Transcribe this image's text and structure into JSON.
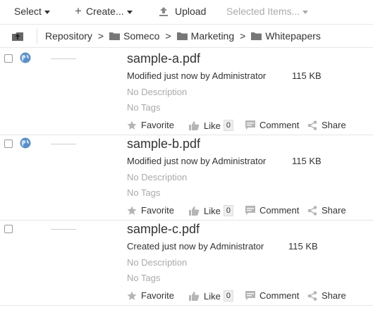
{
  "toolbar": {
    "select_label": "Select",
    "create_label": "Create...",
    "upload_label": "Upload",
    "selected_items_label": "Selected Items..."
  },
  "breadcrumb": {
    "items": [
      "Repository",
      "Someco",
      "Marketing",
      "Whitepapers"
    ],
    "separator": ">"
  },
  "documents": [
    {
      "name": "sample-a.pdf",
      "modified": "Modified just now by Administrator",
      "size": "115 KB",
      "description": "No Description",
      "tags": "No Tags",
      "favorite_label": "Favorite",
      "like_label": "Like",
      "like_count": "0",
      "comment_label": "Comment",
      "share_label": "Share",
      "globe_icon": "globe-icon"
    },
    {
      "name": "sample-b.pdf",
      "modified": "Modified just now by Administrator",
      "size": "115 KB",
      "description": "No Description",
      "tags": "No Tags",
      "favorite_label": "Favorite",
      "like_label": "Like",
      "like_count": "0",
      "comment_label": "Comment",
      "share_label": "Share",
      "globe_icon": "globe-icon"
    },
    {
      "name": "sample-c.pdf",
      "modified": "Created just now by Administrator",
      "size": "115 KB",
      "description": "No Description",
      "tags": "No Tags",
      "favorite_label": "Favorite",
      "like_label": "Like",
      "like_count": "0",
      "comment_label": "Comment",
      "share_label": "Share"
    }
  ],
  "colors": {
    "text": "#333333",
    "muted": "#aaaaaa",
    "divider": "#e6e6e6",
    "icon": "#b0b0b0",
    "globe": "#5b8fc7"
  }
}
